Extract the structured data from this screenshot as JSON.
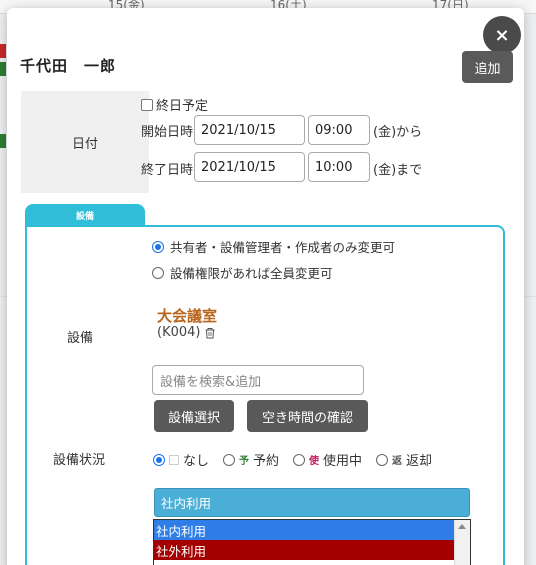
{
  "background": {
    "days": [
      "15(金)",
      "16(土)",
      "17(日)"
    ]
  },
  "modal": {
    "close_icon": "×",
    "user_name": "千代田　一郎",
    "add_label": "追加",
    "date_label": "日付",
    "allday_label": "終日予定",
    "start": {
      "label": "開始日時",
      "date": "2021/10/15",
      "time": "09:00",
      "suffix": "(金)から"
    },
    "end": {
      "label": "終了日時",
      "date": "2021/10/15",
      "time": "10:00",
      "suffix": "(金)まで"
    }
  },
  "equipment": {
    "tab_label": "設備",
    "permission_options": [
      {
        "label": "共有者・設備管理者・作成者のみ変更可",
        "selected": true
      },
      {
        "label": "設備権限があれば全員変更可",
        "selected": false
      }
    ],
    "field_label": "設備",
    "room_name": "大会議室",
    "room_code": "(K004)",
    "search_placeholder": "設備を検索&追加",
    "select_button": "設備選択",
    "availability_button": "空き時間の確認",
    "status_label": "設備状況",
    "status_options": [
      {
        "label": "なし",
        "mark": "",
        "color": "#cccccc",
        "selected": true
      },
      {
        "label": "予約",
        "mark": "予",
        "color": "#2e7d32",
        "selected": false
      },
      {
        "label": "使用中",
        "mark": "使",
        "color": "#c2185b",
        "selected": false
      },
      {
        "label": "返却",
        "mark": "返",
        "color": "#555555",
        "selected": false
      }
    ],
    "usage_selected": "社内利用",
    "usage_options": [
      {
        "label": "社内利用",
        "color": "#2f7ee8"
      },
      {
        "label": "社外利用",
        "color": "#a40000"
      }
    ]
  }
}
